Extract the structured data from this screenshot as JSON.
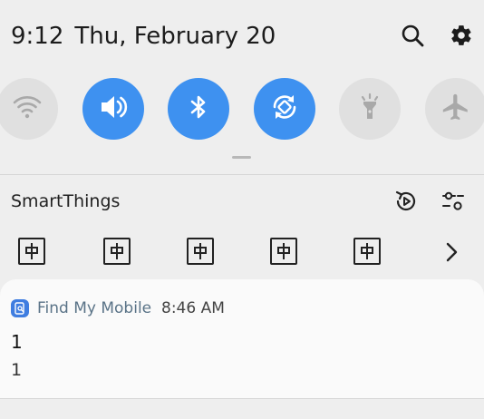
{
  "status": {
    "time": "9:12",
    "date": "Thu, February 20"
  },
  "header_icons": [
    "search-icon",
    "gear-icon"
  ],
  "quick_toggles": [
    {
      "name": "wifi",
      "icon": "wifi-icon",
      "state": "off"
    },
    {
      "name": "sound",
      "icon": "volume-icon",
      "state": "on"
    },
    {
      "name": "bluetooth",
      "icon": "bluetooth-icon",
      "state": "on"
    },
    {
      "name": "auto-rotate",
      "icon": "rotate-icon",
      "state": "on"
    },
    {
      "name": "flashlight",
      "icon": "flashlight-icon",
      "state": "off"
    },
    {
      "name": "airplane-mode",
      "icon": "airplane-icon",
      "state": "off"
    }
  ],
  "colors": {
    "toggle_on": "#3e91f0",
    "toggle_off": "#e0e0e0",
    "app_icon": "#3f7de0",
    "app_name": "#5a7387"
  },
  "smartthings": {
    "title": "SmartThings",
    "icons": [
      "media-output-icon",
      "tune-icon"
    ],
    "devices": [
      "device-icon",
      "device-icon",
      "device-icon",
      "device-icon",
      "device-icon"
    ]
  },
  "notification": {
    "app_name": "Find My Mobile",
    "time": "8:46 AM",
    "title": "1",
    "body": "1"
  }
}
